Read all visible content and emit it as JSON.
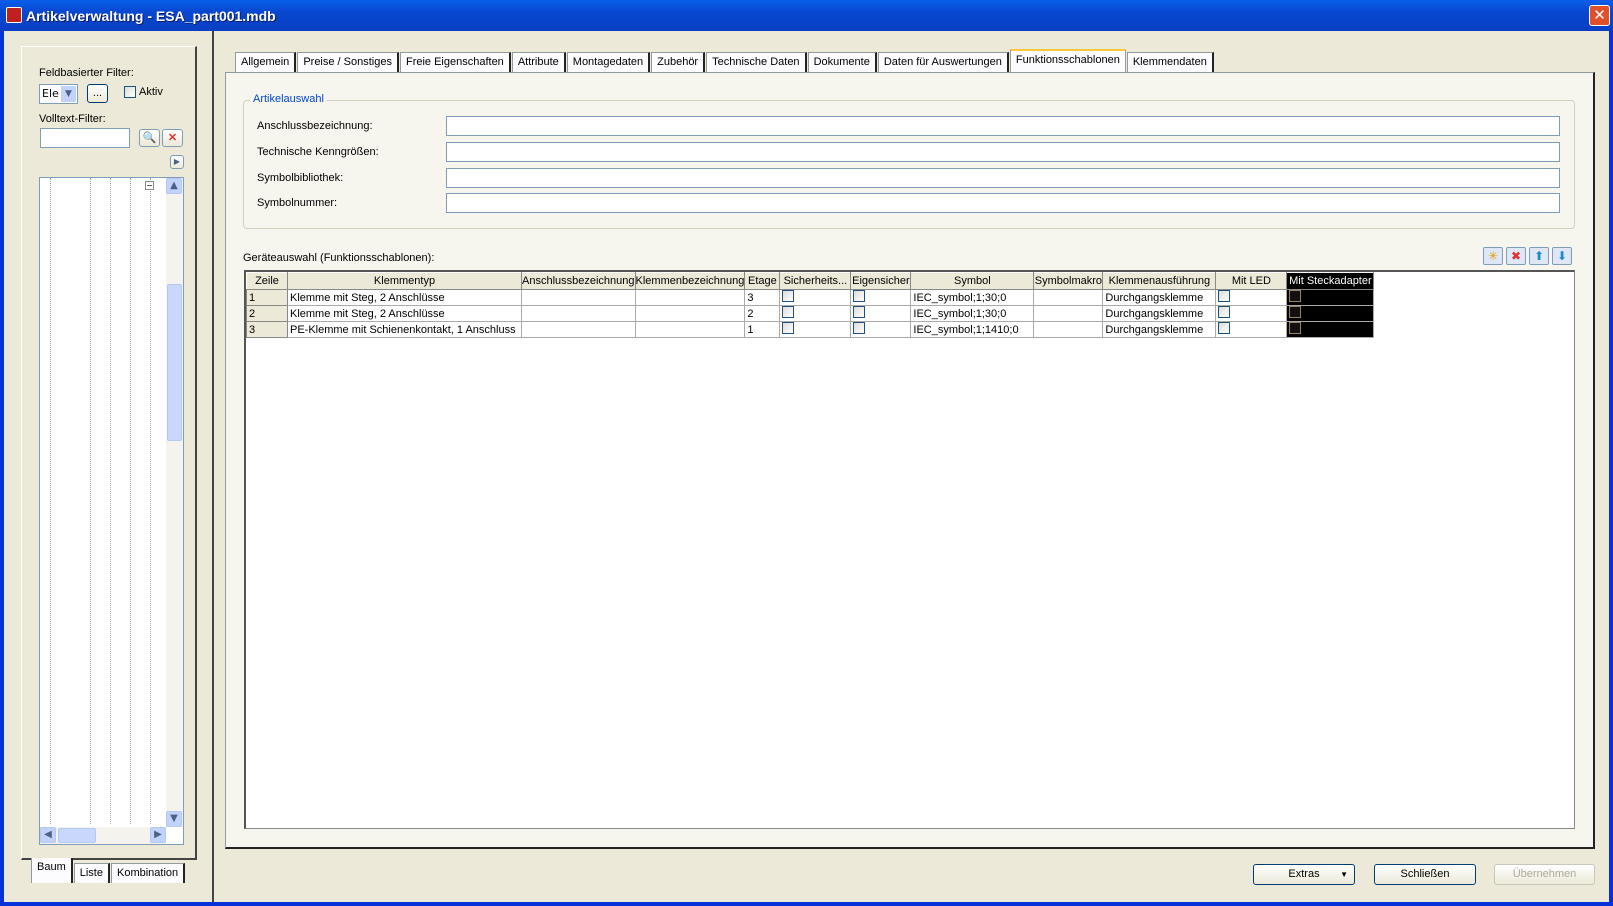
{
  "window": {
    "title": "Artikelverwaltung - ESA_part001.mdb"
  },
  "left": {
    "field_filter_label": "Feldbasierter Filter:",
    "field_filter_value": "Ele",
    "more_button": "...",
    "active_label": "Aktiv",
    "fulltext_label": "Volltext-Filter:",
    "fulltext_value": "",
    "tabs": [
      "Baum",
      "Liste",
      "Kombination"
    ]
  },
  "tabs": [
    "Allgemein",
    "Preise / Sonstiges",
    "Freie Eigenschaften",
    "Attribute",
    "Montagedaten",
    "Zubehör",
    "Technische Daten",
    "Dokumente",
    "Daten für Auswertungen",
    "Funktionsschablonen",
    "Klemmendaten"
  ],
  "active_tab": "Funktionsschablonen",
  "artikelauswahl": {
    "title": "Artikelauswahl",
    "fields": [
      {
        "label": "Anschlussbezeichnung:",
        "value": ""
      },
      {
        "label": "Technische Kenngrößen:",
        "value": ""
      },
      {
        "label": "Symbolbibliothek:",
        "value": ""
      },
      {
        "label": "Symbolnummer:",
        "value": ""
      }
    ]
  },
  "grid": {
    "title": "Geräteauswahl (Funktionsschablonen):",
    "columns": [
      "Zeile",
      "Klemmentyp",
      "Anschlussbezeichnung",
      "Klemmenbezeichnung",
      "Etage",
      "Sicherheits...",
      "Eigensicher",
      "Symbol",
      "Symbolmakro",
      "Klemmenausführung",
      "Mit LED",
      "Mit Steckadapter"
    ],
    "rows": [
      [
        "1",
        "Klemme mit Steg, 2 Anschlüsse",
        "",
        "",
        "3",
        false,
        false,
        "IEC_symbol;1;30;0",
        "",
        "Durchgangsklemme",
        false,
        false
      ],
      [
        "2",
        "Klemme mit Steg, 2 Anschlüsse",
        "",
        "",
        "2",
        false,
        false,
        "IEC_symbol;1;30;0",
        "",
        "Durchgangsklemme",
        false,
        false
      ],
      [
        "3",
        "PE-Klemme mit Schienenkontakt, 1 Anschluss",
        "",
        "",
        "1",
        false,
        false,
        "IEC_symbol;1;1410;0",
        "",
        "Durchgangsklemme",
        false,
        false
      ]
    ]
  },
  "buttons": {
    "extras": "Extras",
    "close": "Schließen",
    "apply": "Übernehmen"
  }
}
